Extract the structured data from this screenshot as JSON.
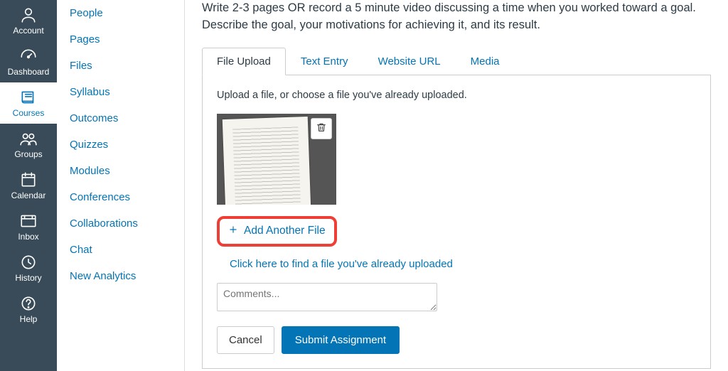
{
  "global_nav": {
    "items": [
      {
        "id": "account",
        "label": "Account"
      },
      {
        "id": "dashboard",
        "label": "Dashboard"
      },
      {
        "id": "courses",
        "label": "Courses"
      },
      {
        "id": "groups",
        "label": "Groups"
      },
      {
        "id": "calendar",
        "label": "Calendar"
      },
      {
        "id": "inbox",
        "label": "Inbox"
      },
      {
        "id": "history",
        "label": "History"
      },
      {
        "id": "help",
        "label": "Help"
      }
    ],
    "active_id": "courses"
  },
  "course_nav": {
    "items": [
      "People",
      "Pages",
      "Files",
      "Syllabus",
      "Outcomes",
      "Quizzes",
      "Modules",
      "Conferences",
      "Collaborations",
      "Chat",
      "New Analytics"
    ]
  },
  "main": {
    "assignment_description": "Write 2-3 pages OR record a 5 minute video discussing a time when you worked toward a goal. Describe the goal, your motivations for achieving it, and its result.",
    "tabs": [
      {
        "id": "file-upload",
        "label": "File Upload"
      },
      {
        "id": "text-entry",
        "label": "Text Entry"
      },
      {
        "id": "website-url",
        "label": "Website URL"
      },
      {
        "id": "media",
        "label": "Media"
      }
    ],
    "active_tab": "file-upload",
    "upload_instructions": "Upload a file, or choose a file you've already uploaded.",
    "add_another_file_label": "Add Another File",
    "find_existing_label": "Click here to find a file you've already uploaded",
    "comments_placeholder": "Comments...",
    "cancel_label": "Cancel",
    "submit_label": "Submit Assignment"
  },
  "colors": {
    "accent": "#0374B5",
    "highlight_border": "#EF3E36"
  }
}
